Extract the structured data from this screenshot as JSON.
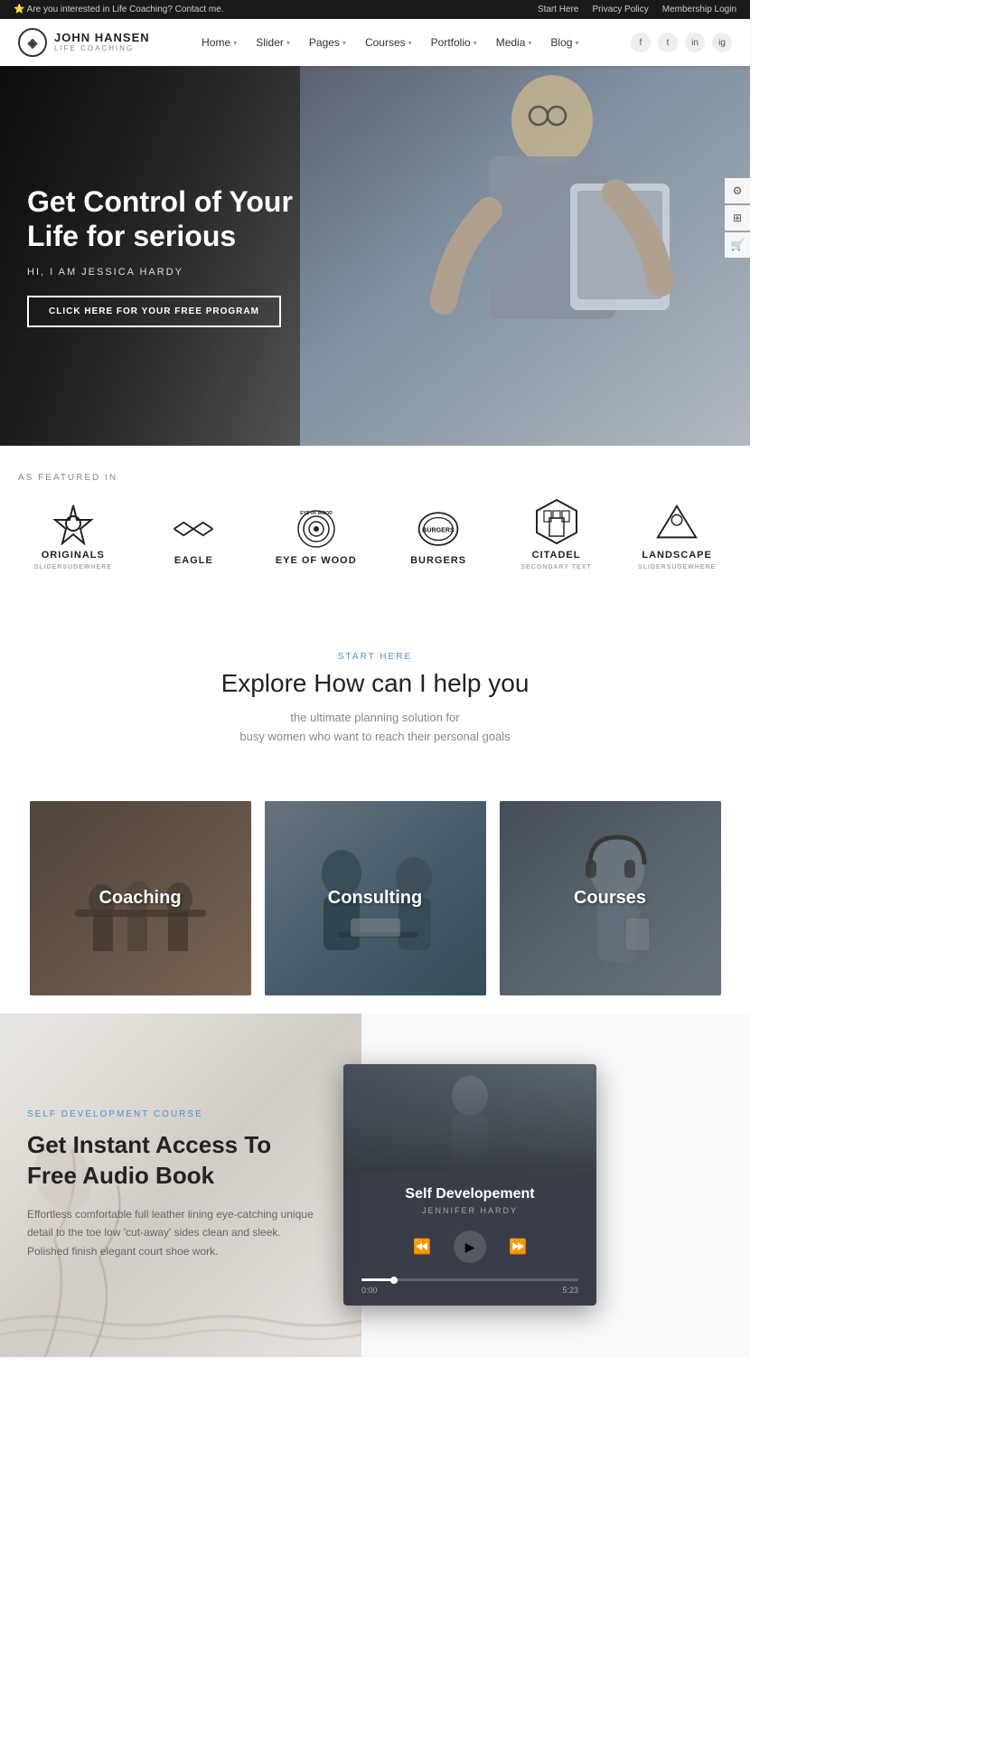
{
  "topbar": {
    "notice": "⭐ Are you interested in Life Coaching? Contact me.",
    "links": [
      "Start Here",
      "Privacy Policy",
      "Membership Login"
    ]
  },
  "header": {
    "logo_name": "JOHN HANSEN",
    "logo_sub": "LIFE COACHING",
    "nav": [
      {
        "label": "Home",
        "has_dropdown": true
      },
      {
        "label": "Slider",
        "has_dropdown": true
      },
      {
        "label": "Pages",
        "has_dropdown": true
      },
      {
        "label": "Courses",
        "has_dropdown": true
      },
      {
        "label": "Portfolio",
        "has_dropdown": true
      },
      {
        "label": "Media",
        "has_dropdown": true
      },
      {
        "label": "Blog",
        "has_dropdown": true
      }
    ],
    "social": [
      "f",
      "t",
      "in",
      "ig"
    ]
  },
  "hero": {
    "title": "Get Control of Your Life for serious",
    "subtitle": "HI, I AM JESSICA HARDY",
    "cta": "CLICK HERE FOR YOUR FREE PROGRAM"
  },
  "featured": {
    "label": "AS FEATURED IN",
    "brands": [
      {
        "name": "ORIGINALS",
        "sub": "SLIDERSUDEWHERE",
        "icon": "◇"
      },
      {
        "name": "EAGLE",
        "sub": "",
        "icon": "⚡"
      },
      {
        "name": "EYE OF WOOD",
        "sub": "",
        "icon": "◎"
      },
      {
        "name": "BURGERS",
        "sub": "",
        "icon": "⬟"
      },
      {
        "name": "CITADEL",
        "sub": "SECONDARY TEXT",
        "icon": "⬡"
      },
      {
        "name": "LANDSCAPE",
        "sub": "SLIDERSUDEWHERE",
        "icon": "⛰"
      }
    ]
  },
  "explore": {
    "label": "START HERE",
    "title": "Explore How can I help you",
    "desc_line1": "the ultimate planning solution for",
    "desc_line2": "busy women who want to reach their personal goals"
  },
  "cards": [
    {
      "label": "Coaching",
      "id": "coaching"
    },
    {
      "label": "Consulting",
      "id": "consulting"
    },
    {
      "label": "Courses",
      "id": "courses"
    }
  ],
  "selfdev": {
    "badge": "SELF DEVELOPMENT COURSE",
    "title": "Get Instant Access To Free Audio Book",
    "desc": "Effortless comfortable full leather lining eye-catching unique detail to the toe low 'cut-away' sides clean and sleek. Polished finish elegant court shoe work."
  },
  "audioplayer": {
    "title": "Self Developement",
    "author": "JENNIFER HARDY",
    "time_current": "0:00",
    "time_total": "5:23",
    "progress_pct": 15
  },
  "side_widgets": [
    "⚙",
    "⊞",
    "🛒"
  ]
}
